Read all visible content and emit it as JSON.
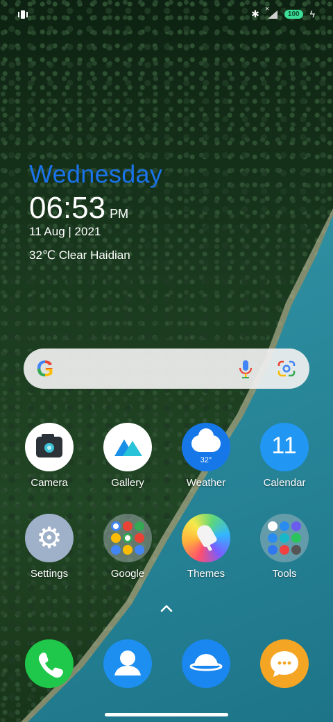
{
  "status_bar": {
    "battery": "100",
    "icons": [
      "vibrate-icon",
      "bluetooth-icon",
      "no-sim-signal-icon",
      "battery-icon",
      "charging-icon"
    ]
  },
  "clock_widget": {
    "day": "Wednesday",
    "time": "06:53",
    "ampm": "PM",
    "date": "11 Aug | 2021",
    "weather": "32℃ Clear Haidian"
  },
  "search_bar": {
    "icons": [
      "google-logo-icon",
      "microphone-icon",
      "google-lens-icon"
    ]
  },
  "apps": [
    {
      "label": "Camera"
    },
    {
      "label": "Gallery"
    },
    {
      "label": "Weather",
      "badge": "32°"
    },
    {
      "label": "Calendar",
      "badge": "11"
    },
    {
      "label": "Settings"
    },
    {
      "label": "Google"
    },
    {
      "label": "Themes"
    },
    {
      "label": "Tools"
    }
  ],
  "dock": [
    "phone",
    "contacts",
    "browser",
    "messages"
  ],
  "colors": {
    "day_accent": "#1a73e8",
    "weather_icon": "#1677e8",
    "calendar_icon": "#2196f3",
    "phone_icon": "#1fc84a",
    "messages_icon": "#f5a524"
  }
}
